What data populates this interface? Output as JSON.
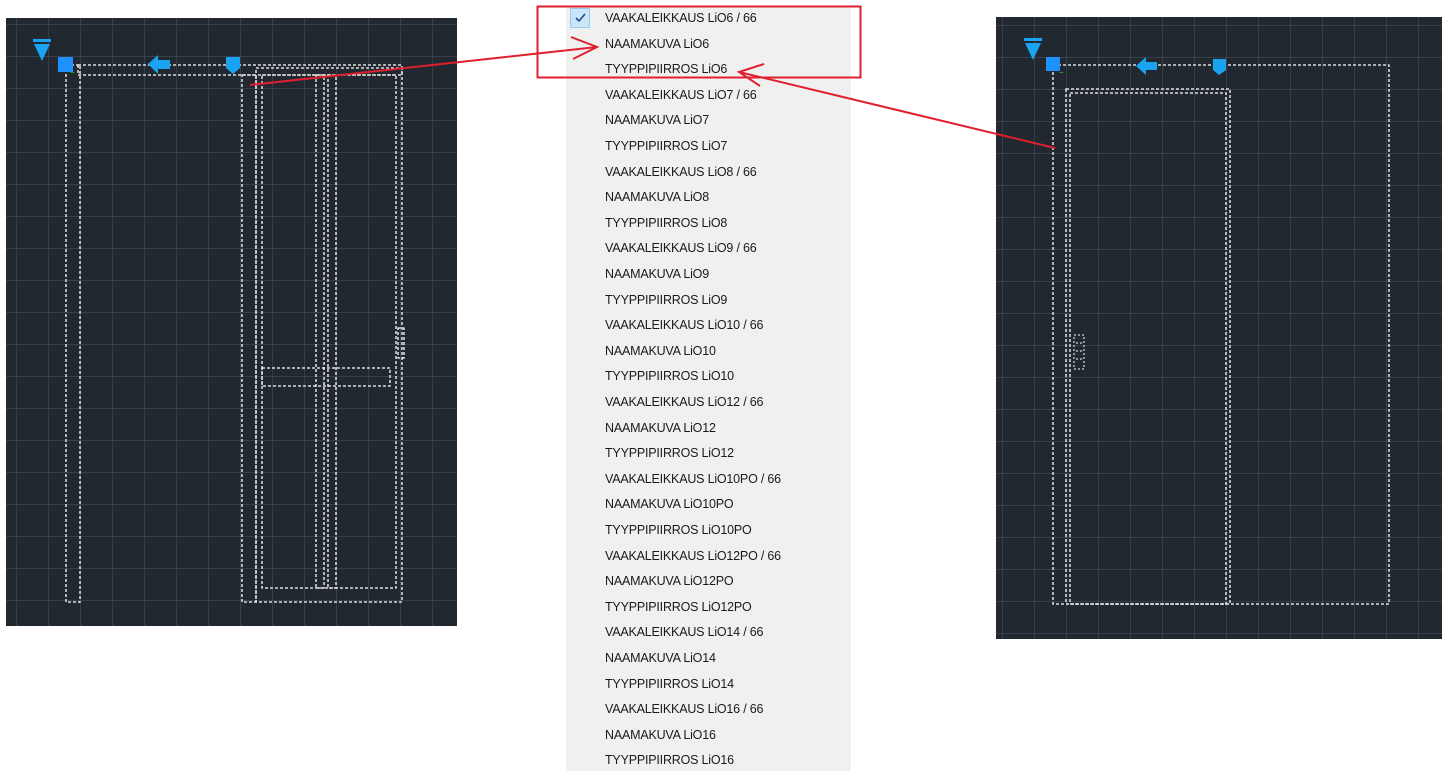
{
  "menu": {
    "items": [
      {
        "label": "VAAKALEIKKAUS LiO6 / 66",
        "checked": true
      },
      {
        "label": "NAAMAKUVA  LiO6"
      },
      {
        "label": "TYYPPIPIIRROS LiO6"
      },
      {
        "label": "VAAKALEIKKAUS LiO7 / 66"
      },
      {
        "label": "NAAMAKUVA  LiO7"
      },
      {
        "label": "TYYPPIPIIRROS LiO7"
      },
      {
        "label": "VAAKALEIKKAUS LiO8 / 66"
      },
      {
        "label": "NAAMAKUVA LiO8"
      },
      {
        "label": "TYYPPIPIIRROS LiO8"
      },
      {
        "label": "VAAKALEIKKAUS LiO9 / 66"
      },
      {
        "label": "NAAMAKUVA LiO9"
      },
      {
        "label": "TYYPPIPIIRROS LiO9"
      },
      {
        "label": "VAAKALEIKKAUS LiO10 / 66"
      },
      {
        "label": "NAAMAKUVA LiO10"
      },
      {
        "label": "TYYPPIPIIRROS LiO10"
      },
      {
        "label": "VAAKALEIKKAUS LiO12 / 66"
      },
      {
        "label": "NAAMAKUVA LiO12"
      },
      {
        "label": "TYYPPIPIIRROS LiO12"
      },
      {
        "label": "VAAKALEIKKAUS LiO10PO / 66"
      },
      {
        "label": "NAAMAKUVA LiO10PO"
      },
      {
        "label": "TYYPPIPIIRROS LiO10PO"
      },
      {
        "label": "VAAKALEIKKAUS LiO12PO / 66"
      },
      {
        "label": "NAAMAKUVA LiO12PO"
      },
      {
        "label": "TYYPPIPIIRROS LiO12PO"
      },
      {
        "label": "VAAKALEIKKAUS LiO14 / 66"
      },
      {
        "label": "NAAMAKUVA LiO14"
      },
      {
        "label": "TYYPPIPIIRROS LiO14"
      },
      {
        "label": "VAAKALEIKKAUS LiO16 / 66"
      },
      {
        "label": "NAAMAKUVA  LiO16"
      },
      {
        "label": "TYYPPIPIIRROS LiO16"
      }
    ],
    "check_icon": "checkmark-icon"
  },
  "icons": {
    "ucs": "ucs-triangle-icon",
    "grip": "blue-square-grip-icon",
    "flip_arrow": "flip-arrow-icon",
    "lookup_grip": "lookup-grip-icon"
  },
  "colors": {
    "cad_background": "#212830",
    "grip_blue": "#1e90ff",
    "cyan_glyph": "#19a3f0",
    "annotation_red": "#e0202e",
    "menu_background": "#f0f0f0",
    "checked_highlight": "#cce4f7"
  }
}
